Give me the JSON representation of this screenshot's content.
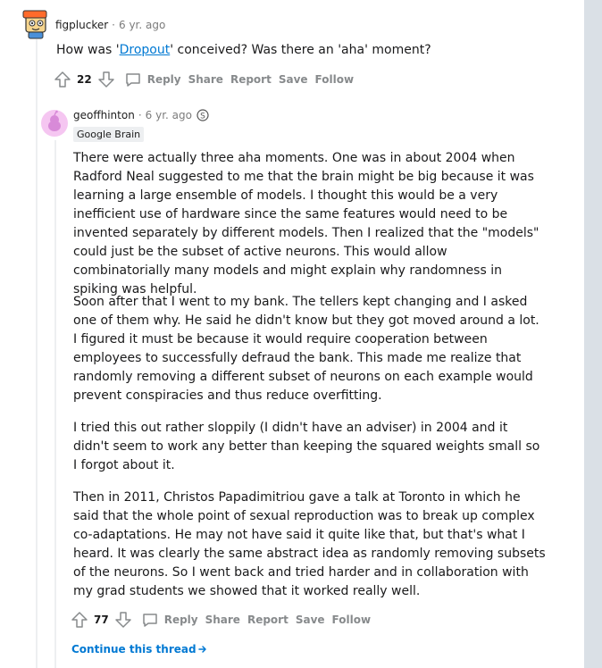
{
  "comment_parent": {
    "author": "figplucker",
    "time": "6 yr. ago",
    "body_before": "How was '",
    "body_link": "Dropout",
    "body_after": "' conceived? Was there an 'aha' moment?",
    "score": "22",
    "actions": {
      "reply": "Reply",
      "share": "Share",
      "report": "Report",
      "save": "Save",
      "follow": "Follow"
    }
  },
  "comment_reply": {
    "author": "geoffhinton",
    "time": "6 yr. ago",
    "award_icon": "silver-award-icon",
    "flair": "Google Brain",
    "paragraphs": [
      "There were actually three aha moments. One was in about 2004 when Radford Neal suggested to me that the brain might be big because it was learning a large ensemble of models. I thought this would be a very inefficient use of hardware since the same features would need to be invented separately by different models. Then I realized that the \"models\" could just be the subset of active neurons. This would allow combinatorially many models and might explain why randomness in spiking was helpful.",
      "Soon after that I went to my bank. The tellers kept changing and I asked one of them why. He said he didn't know but they got moved around a lot. I figured it must be because it would require cooperation between employees to successfully defraud the bank. This made me realize that randomly removing a different subset of neurons on each example would prevent conspiracies and thus reduce overfitting.",
      "I tried this out rather sloppily (I didn't have an adviser) in 2004 and it didn't seem to work any better than keeping the squared weights small so I forgot about it.",
      "Then in 2011, Christos Papadimitriou gave a talk at Toronto in which he said that the whole point of sexual reproduction was to break up complex co-adaptations. He may not have said it quite like that, but that's what I heard. It was clearly the same abstract idea as randomly removing subsets of the neurons. So I went back and tried harder and in collaboration with my grad students we showed that it worked really well."
    ],
    "score": "77",
    "actions": {
      "reply": "Reply",
      "share": "Share",
      "report": "Report",
      "save": "Save",
      "follow": "Follow"
    }
  },
  "continue_thread": "Continue this thread",
  "colors": {
    "link": "#0079d3",
    "meta": "#7c7c7c",
    "action": "#878a8c"
  }
}
